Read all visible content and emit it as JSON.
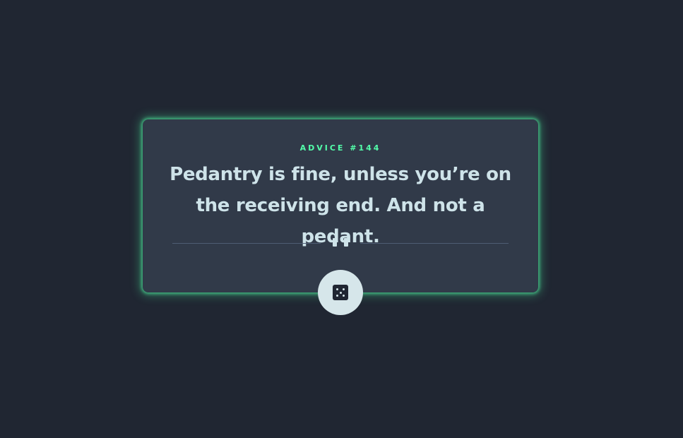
{
  "card": {
    "advice_label": "ADVICE #144",
    "quote": "Pedantry is fine, unless you’re on the receiving end. And not a pedant."
  },
  "divider": {
    "icon": "pause-icon"
  },
  "dice_button": {
    "icon": "dice-icon"
  },
  "colors": {
    "background": "#202632",
    "card": "#313a49",
    "accent": "#53ffaa",
    "text": "#cee3e9",
    "button": "#d6e6ea"
  }
}
